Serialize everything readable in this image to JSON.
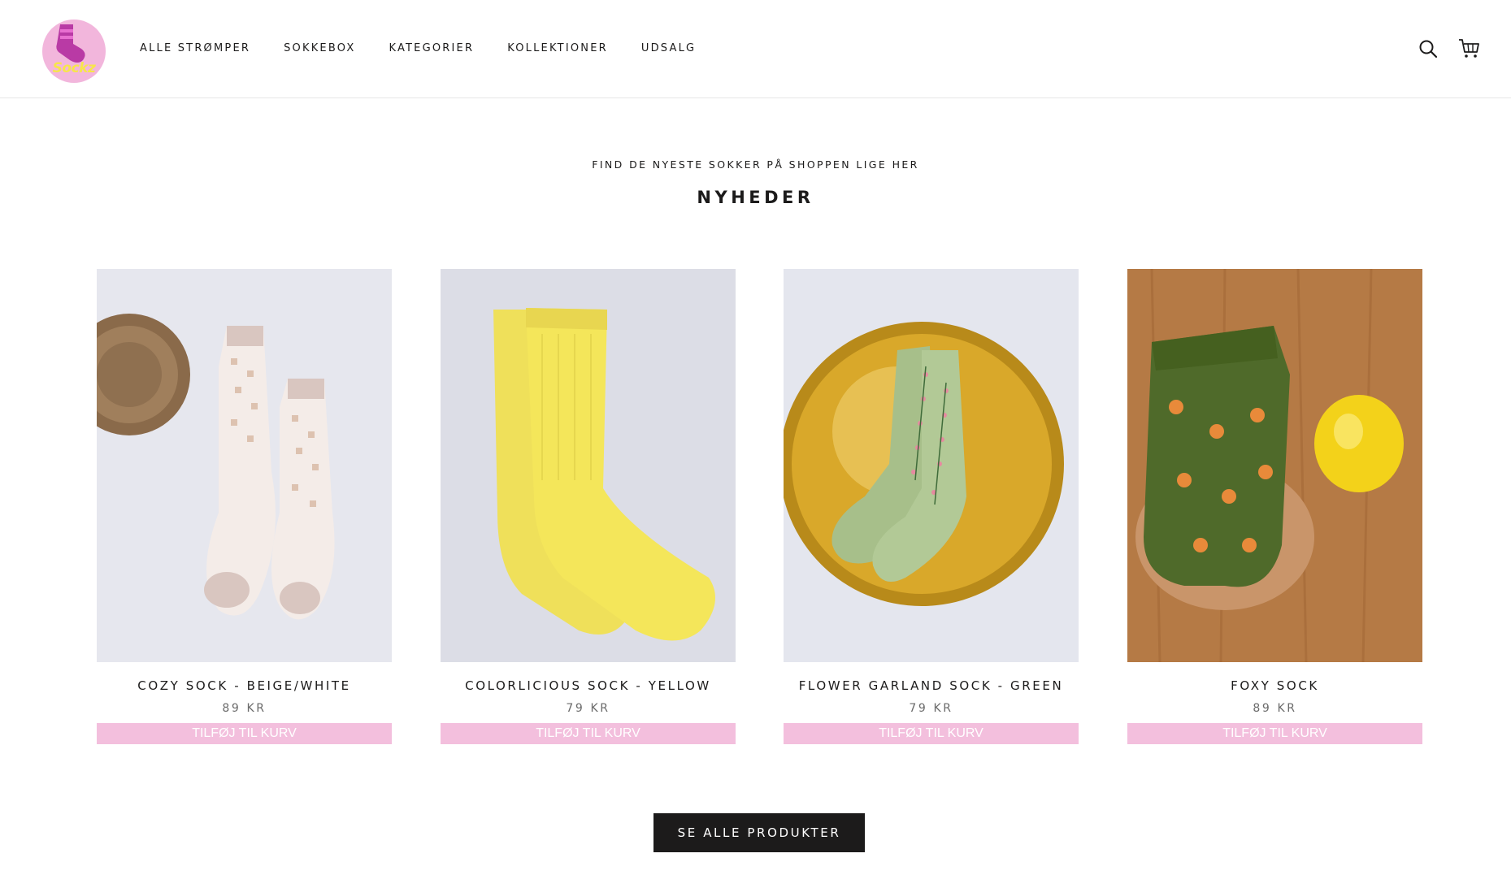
{
  "brand": {
    "logo_text": "Sockz"
  },
  "nav": {
    "items": [
      {
        "label": "ALLE STRØMPER"
      },
      {
        "label": "SOKKEBOX"
      },
      {
        "label": "KATEGORIER"
      },
      {
        "label": "KOLLEKTIONER"
      },
      {
        "label": "UDSALG"
      }
    ]
  },
  "header_icons": {
    "search": "search-icon",
    "cart": "cart-icon"
  },
  "section": {
    "kicker": "FIND DE NYESTE SOKKER PÅ SHOPPEN LIGE HER",
    "title": "NYHEDER"
  },
  "products": [
    {
      "name": "COZY SOCK - BEIGE/WHITE",
      "price": "89 KR",
      "add_label": "TILFØJ TIL KURV"
    },
    {
      "name": "COLORLICIOUS SOCK - YELLOW",
      "price": "79 KR",
      "add_label": "TILFØJ TIL KURV"
    },
    {
      "name": "FLOWER GARLAND SOCK - GREEN",
      "price": "79 KR",
      "add_label": "TILFØJ TIL KURV"
    },
    {
      "name": "FOXY SOCK",
      "price": "89 KR",
      "add_label": "TILFØJ TIL KURV"
    }
  ],
  "cta": {
    "label": "SE ALLE PRODUKTER"
  },
  "colors": {
    "text": "#1c1b1b",
    "price": "#6a6a6a",
    "add_button_bg": "#f3bfdd",
    "cta_bg": "#1c1b1b",
    "logo_bg": "#f2b6dc"
  }
}
